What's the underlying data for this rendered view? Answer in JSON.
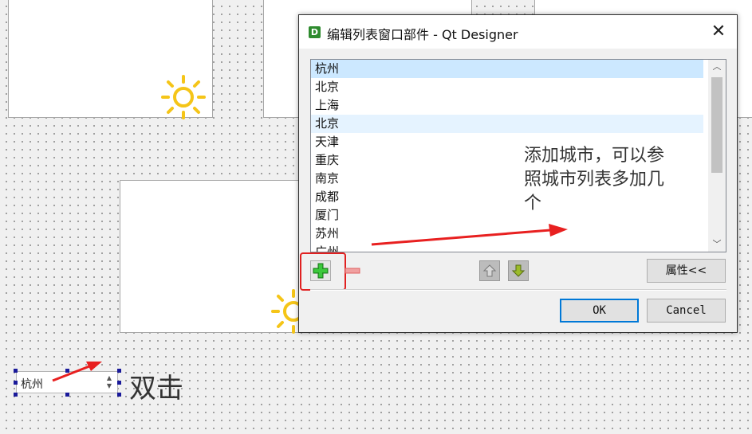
{
  "dialog": {
    "title": "编辑列表窗口部件 - Qt Designer",
    "app_icon": "D",
    "close_glyph": "✕",
    "list_items": [
      "杭州",
      "北京",
      "上海",
      "北京",
      "天津",
      "重庆",
      "南京",
      "成都",
      "厦门",
      "苏州",
      "广州"
    ],
    "buttons": {
      "properties": "属性<<",
      "ok": "OK",
      "cancel": "Cancel"
    }
  },
  "annotation": {
    "line1": "添加城市，可以参",
    "line2": "照城市列表多加几",
    "line3": "个"
  },
  "form": {
    "combo_value": "杭州",
    "double_click_label": "双击"
  },
  "colors": {
    "accent": "#0078d7",
    "selection": "#cce8ff",
    "annotation_red": "#e02020",
    "sun": "#f5c518",
    "add_green": "#2fb52f",
    "remove_red": "#e06060"
  },
  "icons": [
    "sun-icon",
    "app-icon",
    "close-icon",
    "add-icon",
    "remove-icon",
    "move-up-icon",
    "move-down-icon",
    "scroll-up-icon",
    "scroll-down-icon",
    "spin-arrows-icon"
  ]
}
